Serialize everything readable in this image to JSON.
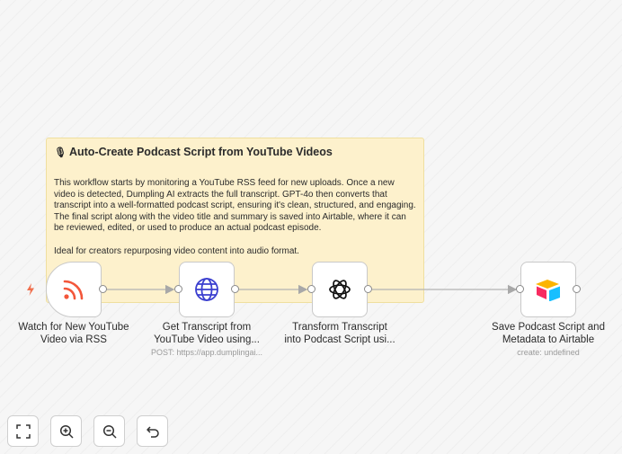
{
  "sticky_note": {
    "icon": "microphone-icon",
    "title": "Auto-Create Podcast Script from YouTube Videos",
    "description": "This workflow starts by monitoring a YouTube RSS feed for new uploads. Once a new video is detected, Dumpling AI extracts the full transcript. GPT-4o then converts that transcript into a well-formatted podcast script, ensuring it's clean, structured, and engaging. The final script along with the video title and summary is saved into Airtable, where it can be reviewed, edited, or used to produce an actual podcast episode.",
    "note": "Ideal for creators repurposing video content into audio format."
  },
  "nodes": [
    {
      "label_line1": "Watch for New YouTube",
      "label_line2": "Video via RSS",
      "subtitle": "",
      "icon": "rss-icon"
    },
    {
      "label_line1": "Get Transcript from",
      "label_line2": "YouTube Video using...",
      "subtitle": "POST: https://app.dumplingai...",
      "icon": "globe-icon"
    },
    {
      "label_line1": "Transform Transcript",
      "label_line2": "into Podcast Script usi...",
      "subtitle": "",
      "icon": "openai-icon"
    },
    {
      "label_line1": "Save Podcast Script and",
      "label_line2": "Metadata to Airtable",
      "subtitle": "create: undefined",
      "icon": "airtable-icon"
    }
  ],
  "controls": [
    {
      "name": "fit-view",
      "icon": "fullscreen-icon"
    },
    {
      "name": "zoom-in",
      "icon": "zoom-in-icon"
    },
    {
      "name": "zoom-out",
      "icon": "zoom-out-icon"
    },
    {
      "name": "reset",
      "icon": "undo-icon"
    }
  ],
  "colors": {
    "sticky_bg": "#fdf1cc",
    "rss": "#f3563a",
    "globe": "#3b3fcf",
    "trigger_bolt": "#f06f4d"
  }
}
